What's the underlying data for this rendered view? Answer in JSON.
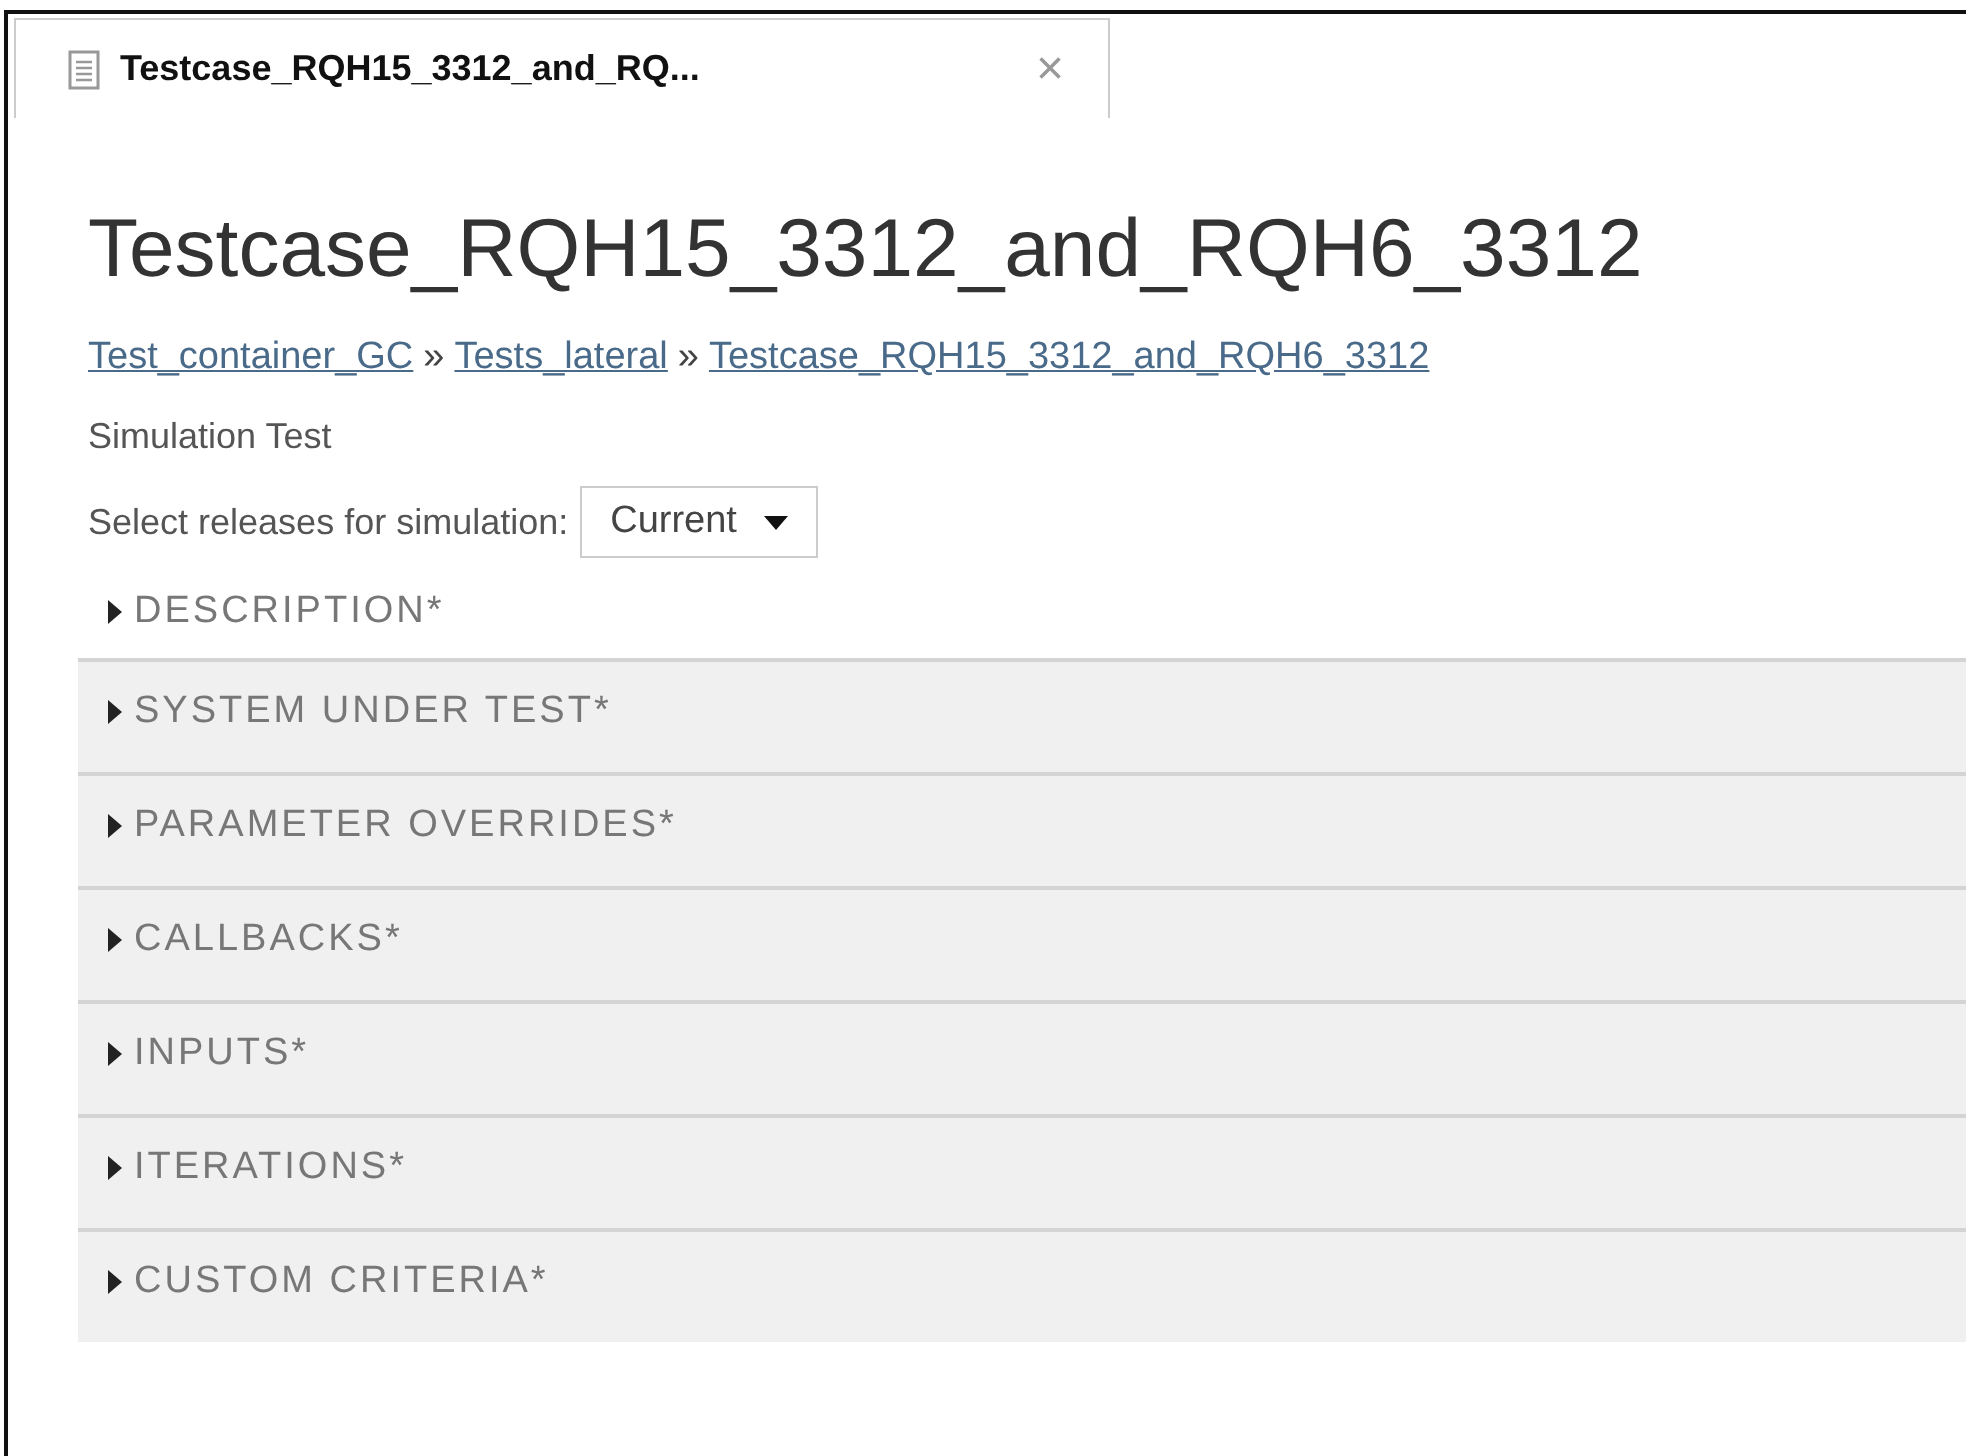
{
  "tab": {
    "title": "Testcase_RQH15_3312_and_RQ...",
    "close": "×",
    "selected": true
  },
  "page": {
    "title": "Testcase_RQH15_3312_and_RQH6_3312",
    "breadcrumbs": [
      {
        "label": "Test_container_GC"
      },
      {
        "label": "Tests_lateral"
      },
      {
        "label": "Testcase_RQH15_3312_and_RQH6_3312"
      }
    ],
    "separator": "»",
    "test_type": "Simulation Test",
    "release_label": "Select releases for simulation:",
    "release_value": "Current"
  },
  "sections": [
    {
      "label": "DESCRIPTION*",
      "kind": "plain",
      "expanded": false
    },
    {
      "label": "SYSTEM UNDER TEST*",
      "kind": "panel",
      "expanded": false
    },
    {
      "label": "PARAMETER OVERRIDES*",
      "kind": "panel",
      "expanded": false
    },
    {
      "label": "CALLBACKS*",
      "kind": "panel",
      "expanded": false
    },
    {
      "label": "INPUTS*",
      "kind": "panel",
      "expanded": false
    },
    {
      "label": "ITERATIONS*",
      "kind": "panel",
      "expanded": false
    },
    {
      "label": "CUSTOM CRITERIA*",
      "kind": "panel",
      "expanded": false
    }
  ]
}
